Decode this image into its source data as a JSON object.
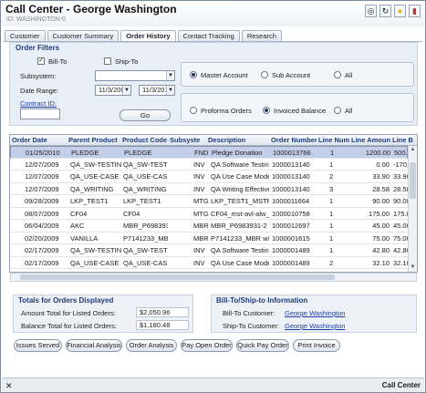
{
  "header": {
    "title": "Call Center - George Washington",
    "subtitle": "ID: WASHINGTON-0",
    "icons": [
      "glasses-icon",
      "refresh-icon",
      "lightbulb-icon",
      "document-icon"
    ]
  },
  "tabs": [
    {
      "label": "Customer"
    },
    {
      "label": "Customer Summary"
    },
    {
      "label": "Order History",
      "active": true
    },
    {
      "label": "Contact Tracking"
    },
    {
      "label": "Research"
    }
  ],
  "filters": {
    "legend": "Order Filters",
    "bill_to_label": "Bill-To",
    "bill_to_checked": true,
    "ship_to_label": "Ship-To",
    "ship_to_checked": false,
    "subsystem_label": "Subsystem:",
    "subsystem_value": "",
    "date_range_label": "Date Range:",
    "date_from": "11/3/2008",
    "date_to": "11/3/2010",
    "contract_label": "Contract ID:",
    "contract_value": "",
    "go_label": "Go",
    "account_options": [
      "Master Account",
      "Sub Account",
      "All"
    ],
    "account_selected": 0,
    "balance_options": [
      "Proforma Orders",
      "Invoiced Balance",
      "All"
    ],
    "balance_selected": 1
  },
  "grid": {
    "columns": [
      "Order Date",
      "Parent Product",
      "Product Code",
      "Subsyste",
      "Description",
      "Order Number",
      "Line Num",
      "Line Amoun",
      "Line B"
    ],
    "rows": [
      [
        "01/25/2010",
        "PLEDGE",
        "PLEDGE",
        "FND",
        "Pledge Donation",
        "1000013766",
        "1",
        "1200.00",
        "500.0"
      ],
      [
        "12/07/2009",
        "QA_SW-TESTIN",
        "QA_SW-TESTIN",
        "INV",
        "QA Software Testing",
        "1000013140",
        "1",
        "0.00",
        "-170.-"
      ],
      [
        "12/07/2009",
        "QA_USE-CASE",
        "QA_USE-CASE",
        "INV",
        "QA Use Case Modeli",
        "1000013140",
        "2",
        "33.90",
        "33.90"
      ],
      [
        "12/07/2009",
        "QA_WRITING",
        "QA_WRITING",
        "INV",
        "QA Writing Effective",
        "1000013140",
        "3",
        "28.58",
        "28.58"
      ],
      [
        "09/28/2009",
        "LKP_TEST1",
        "LKP_TEST1",
        "MTG",
        "LKP_TEST1_MSTR",
        "1000011664",
        "1",
        "90.00",
        "90.00"
      ],
      [
        "08/07/2009",
        "CF04",
        "CF04",
        "MTG",
        "CF04_mst-avl-alw_D",
        "1000010758",
        "1",
        "175.00",
        "175.00"
      ],
      [
        "06/04/2009",
        "AKC",
        "MBR_P6983931-",
        "MBR",
        "MBR_P6983931-2",
        "1000012697",
        "1",
        "45.00",
        "45.00"
      ],
      [
        "02/20/2009",
        "VANILLA",
        "P7141233_MBR",
        "MBR",
        "P7141233_MBR w/S",
        "1000001615",
        "1",
        "75.00",
        "75.00"
      ],
      [
        "02/17/2009",
        "QA_SW-TESTIN",
        "QA_SW-TESTIN",
        "INV",
        "QA Software Testing",
        "1000001489",
        "1",
        "42.80",
        "42.80"
      ],
      [
        "02/17/2009",
        "QA_USE-CASE",
        "QA_USE-CASE",
        "INV",
        "QA Use Case Modeli",
        "1000001489",
        "2",
        "32.10",
        "32.10"
      ]
    ],
    "selected_row": 0
  },
  "totals": {
    "title": "Totals for Orders Displayed",
    "amount_label": "Amount Total for Listed Orders:",
    "amount_value": "$2,050.96",
    "balance_label": "Balance Total for Listed Orders:",
    "balance_value": "$1,180.48"
  },
  "billship": {
    "title": "Bill-To/Ship-to Information",
    "bill_label": "Bill-To Customer:",
    "bill_value": "George Washington",
    "ship_label": "Ship-To Customer:",
    "ship_value": "George Washington"
  },
  "actions": [
    "Issues Served",
    "Financial Analysis",
    "Order Analysis",
    "Pay Open Order",
    "Quick Pay Order",
    "Print Invoice"
  ],
  "status": {
    "close": "✕",
    "text": "Call Center"
  }
}
